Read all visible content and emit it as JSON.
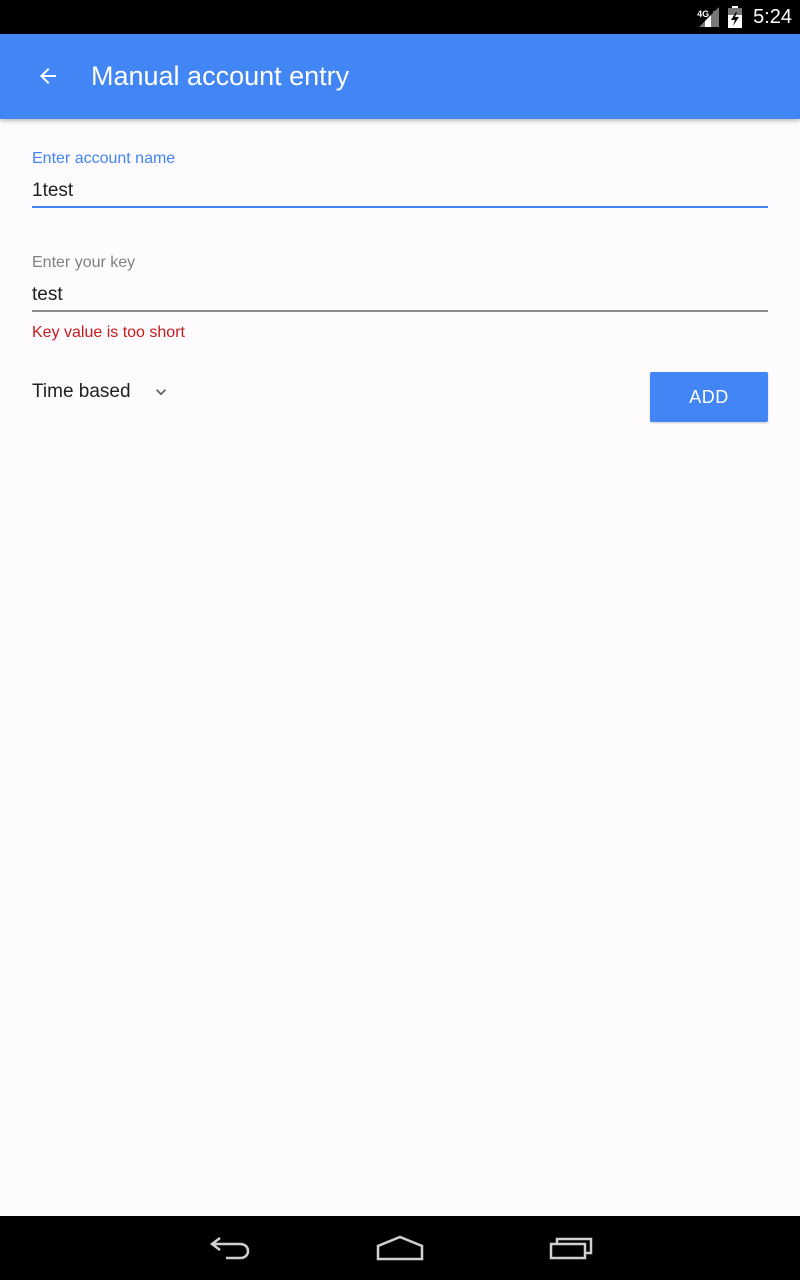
{
  "status_bar": {
    "network": "4G",
    "time": "5:24",
    "icons": [
      "signal-icon",
      "battery-icon"
    ]
  },
  "app_bar": {
    "title": "Manual account entry",
    "back_icon": "arrow-back-icon",
    "color": "#4285f4"
  },
  "form": {
    "account_name": {
      "label": "Enter account name",
      "value": "1test"
    },
    "key": {
      "label": "Enter your key",
      "value": "test",
      "error": "Key value is too short"
    },
    "type_select": {
      "value": "Time based",
      "icon": "chevron-down-icon"
    },
    "add_button": {
      "label": "ADD"
    }
  },
  "nav_bar": {
    "icons": [
      "back-icon",
      "home-icon",
      "recents-icon"
    ]
  },
  "colors": {
    "accent": "#4285f4",
    "error": "#c61b1b",
    "background": "#fdfbfe"
  }
}
